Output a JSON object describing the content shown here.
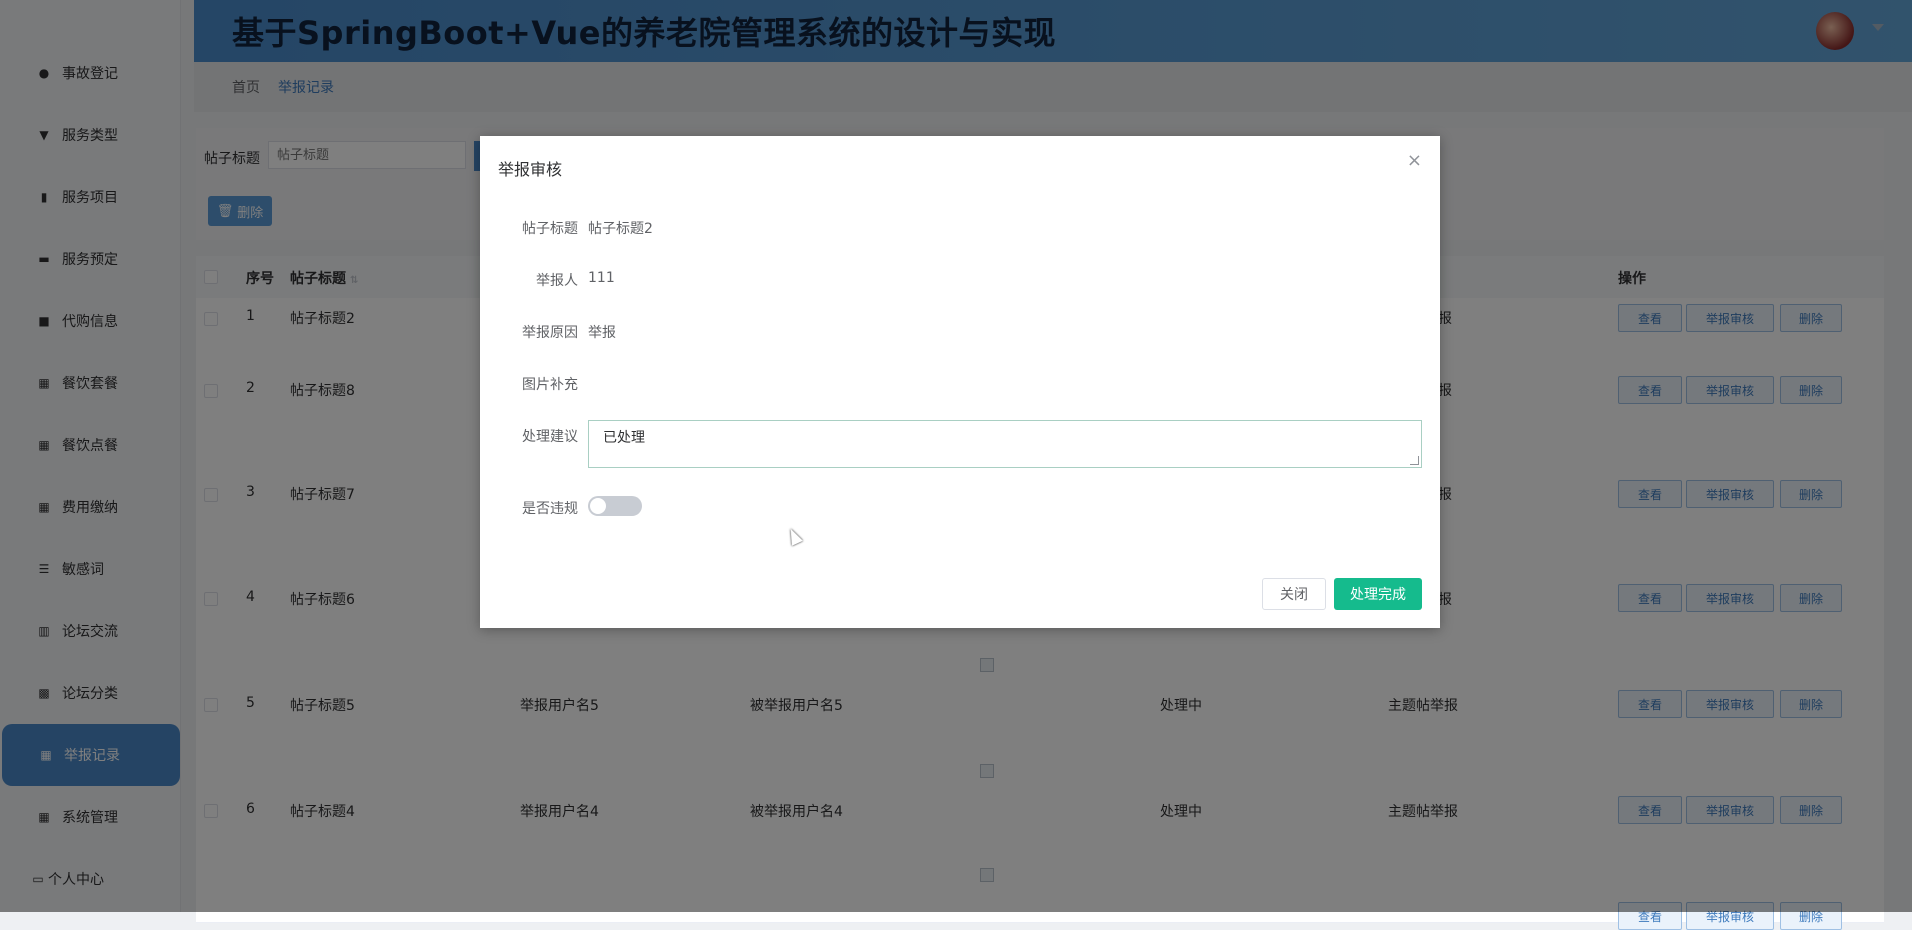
{
  "header": {
    "title": "基于SpringBoot+Vue的养老院管理系统的设计与实现"
  },
  "sidebar": {
    "items": [
      {
        "label": "事故登记",
        "icon": "user-icon"
      },
      {
        "label": "服务类型",
        "icon": "cup-icon"
      },
      {
        "label": "服务项目",
        "icon": "clipboard-icon"
      },
      {
        "label": "服务预定",
        "icon": "ticket-icon"
      },
      {
        "label": "代购信息",
        "icon": "briefcase-icon"
      },
      {
        "label": "餐饮套餐",
        "icon": "grid-icon"
      },
      {
        "label": "餐饮点餐",
        "icon": "grid-icon"
      },
      {
        "label": "费用缴纳",
        "icon": "grid-icon"
      },
      {
        "label": "敏感词",
        "icon": "sliders-icon"
      },
      {
        "label": "论坛交流",
        "icon": "chart-icon"
      },
      {
        "label": "论坛分类",
        "icon": "apps-icon"
      },
      {
        "label": "举报记录",
        "icon": "grid-icon",
        "active": true
      },
      {
        "label": "系统管理",
        "icon": "grid-icon"
      }
    ],
    "personal": "个人中心"
  },
  "breadcrumb": {
    "home": "首页",
    "current": "举报记录"
  },
  "search": {
    "label": "帖子标题",
    "placeholder": "帖子标题",
    "delete_label": "删除"
  },
  "table": {
    "headers": {
      "index": "序号",
      "title": "帖子标题",
      "ops": "操作"
    },
    "rows": [
      {
        "index": "1",
        "title": "帖子标题2",
        "tail": "报"
      },
      {
        "index": "2",
        "title": "帖子标题8",
        "tail": "报"
      },
      {
        "index": "3",
        "title": "帖子标题7",
        "tail": "报"
      },
      {
        "index": "4",
        "title": "帖子标题6",
        "tail": "报"
      },
      {
        "index": "5",
        "title": "帖子标题5",
        "reporter": "举报用户名5",
        "reported": "被举报用户名5",
        "status": "处理中",
        "type": "主题帖举报"
      },
      {
        "index": "6",
        "title": "帖子标题4",
        "reporter": "举报用户名4",
        "reported": "被举报用户名4",
        "status": "处理中",
        "type": "主题帖举报"
      }
    ],
    "ops": {
      "view": "查看",
      "audit": "举报审核",
      "delete": "删除"
    }
  },
  "dialog": {
    "title": "举报审核",
    "close_x": "×",
    "fields": {
      "title_label": "帖子标题",
      "title_value": "帖子标题2",
      "reporter_label": "举报人",
      "reporter_value": "111",
      "reason_label": "举报原因",
      "reason_value": "举报",
      "image_label": "图片补充",
      "advice_label": "处理建议",
      "advice_value": "已处理",
      "violation_label": "是否违规"
    },
    "violation_on": false,
    "close_label": "关闭",
    "done_label": "处理完成",
    "done_color": "#15bb8d"
  }
}
